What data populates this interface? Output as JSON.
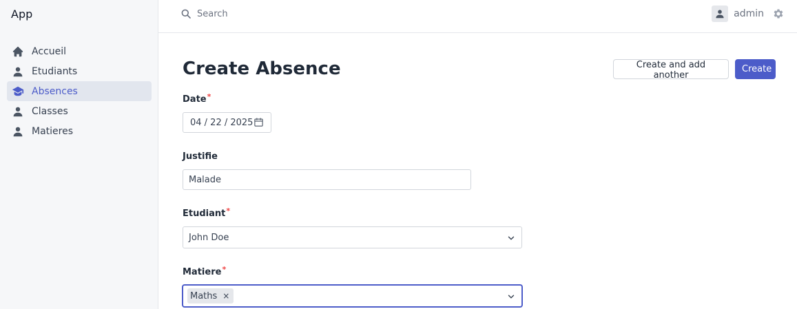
{
  "app": {
    "title": "App"
  },
  "sidebar": {
    "items": [
      {
        "label": "Accueil",
        "icon": "home-icon",
        "active": false
      },
      {
        "label": "Etudiants",
        "icon": "user-icon",
        "active": false
      },
      {
        "label": "Absences",
        "icon": "academic-cap-icon",
        "active": true
      },
      {
        "label": "Classes",
        "icon": "user-icon",
        "active": false
      },
      {
        "label": "Matieres",
        "icon": "user-icon",
        "active": false
      }
    ]
  },
  "topbar": {
    "search_placeholder": "Search",
    "username": "admin"
  },
  "page": {
    "title": "Create Absence",
    "create_another_label": "Create and add another",
    "create_label": "Create"
  },
  "form": {
    "date": {
      "label": "Date",
      "required_mark": "*",
      "value": "04 / 22 / 2025"
    },
    "justifie": {
      "label": "Justifie",
      "value": "Malade"
    },
    "etudiant": {
      "label": "Etudiant",
      "required_mark": "*",
      "value": "John Doe"
    },
    "matiere": {
      "label": "Matiere",
      "required_mark": "*",
      "selected": [
        "Maths"
      ],
      "remove_glyph": "×"
    }
  },
  "colors": {
    "accent": "#4c5cc9",
    "required": "#ef4444"
  }
}
